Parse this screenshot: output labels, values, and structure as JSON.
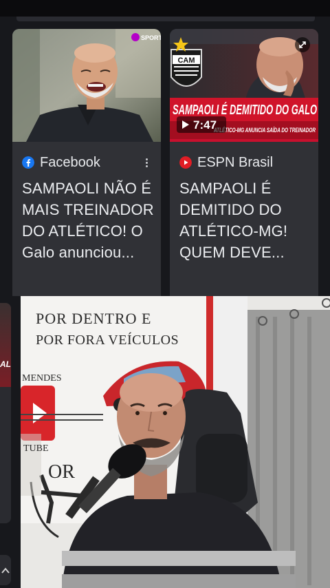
{
  "cards": [
    {
      "source": "Facebook",
      "source_icon": "facebook-icon",
      "headline": "SAMPAOLI NÃO É MAIS TREINADOR DO ATLÉTICO! O Galo anunciou...",
      "thumbnail_badge": "SPORTS"
    },
    {
      "source": "ESPN Brasil",
      "source_icon": "youtube-icon",
      "headline": "SAMPAOLI É DEMITIDO DO ATLÉTICO-MG! QUEM DEVE...",
      "thumbnail_banner": "SAMPAOLI É DEMITIDO DO GALO",
      "thumbnail_subbanner": "ATLÉTICO-MG ANUNCIA SAÍDA DO TREINADOR",
      "duration": "7:47",
      "crest_text": "CAM"
    }
  ],
  "overlay_video": {
    "banner_line1": "POR DENTRO E",
    "banner_line2": "POR FORA VEÍCULOS",
    "banner_side": "MENDES",
    "banner_tube": "TUBE",
    "banner_bottom": "OR"
  },
  "side_card": {
    "label": "ALI"
  },
  "colors": {
    "background": "#17181c",
    "card": "#303136",
    "facebook": "#1877f2",
    "youtube_red": "#e11d25"
  }
}
